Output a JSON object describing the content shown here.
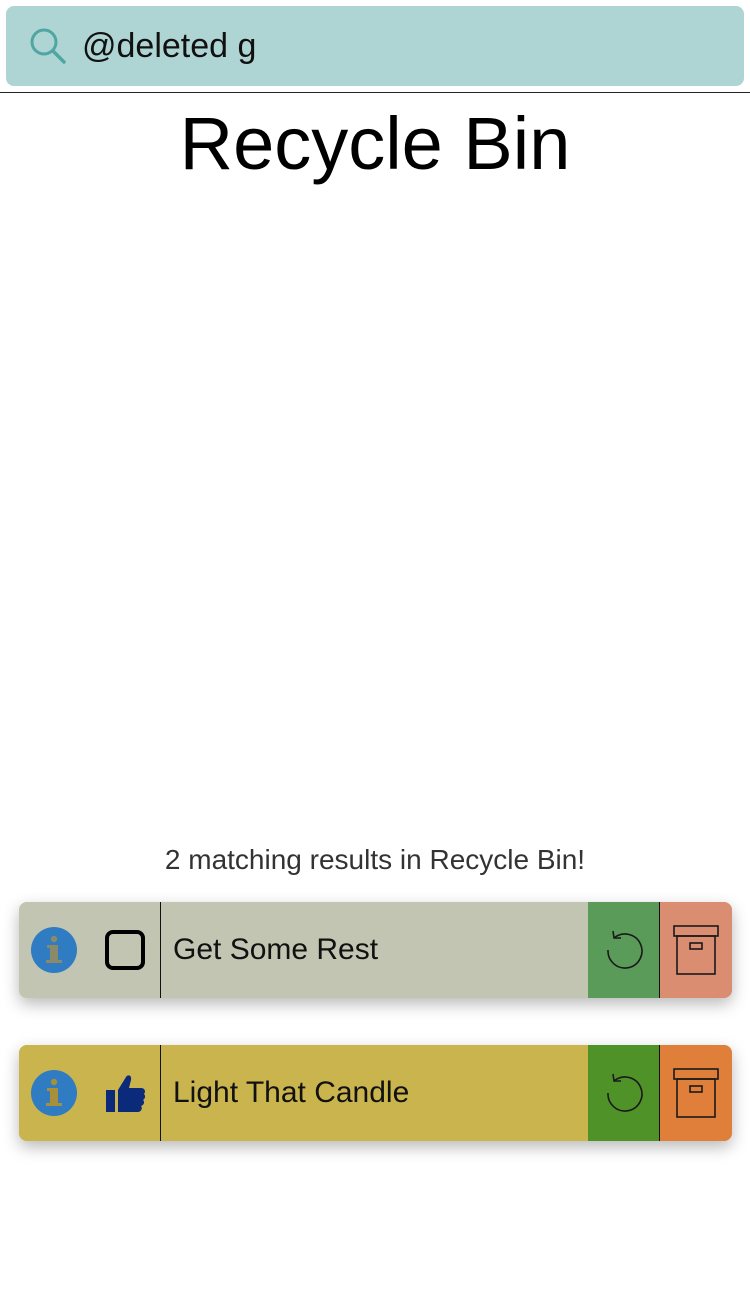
{
  "search": {
    "value": "@deleted g",
    "icon": "search-icon"
  },
  "page": {
    "title": "Recycle Bin",
    "results_text": "2 matching results in Recycle Bin!"
  },
  "items": [
    {
      "title": "Get Some Rest",
      "status_icon": "checkbox-unchecked-icon",
      "colors": {
        "row": "#c3c5b3",
        "restore": "#5b9b5a",
        "archive": "#db8d72"
      }
    },
    {
      "title": "Light That Candle",
      "status_icon": "thumbs-up-icon",
      "colors": {
        "row": "#c9b44e",
        "restore": "#4f9228",
        "archive": "#df7f3a"
      }
    }
  ],
  "colors": {
    "search_bar": "#aed5d4",
    "info_icon": "#2f7cc2",
    "thumbs_up_icon": "#0b2a7a"
  }
}
